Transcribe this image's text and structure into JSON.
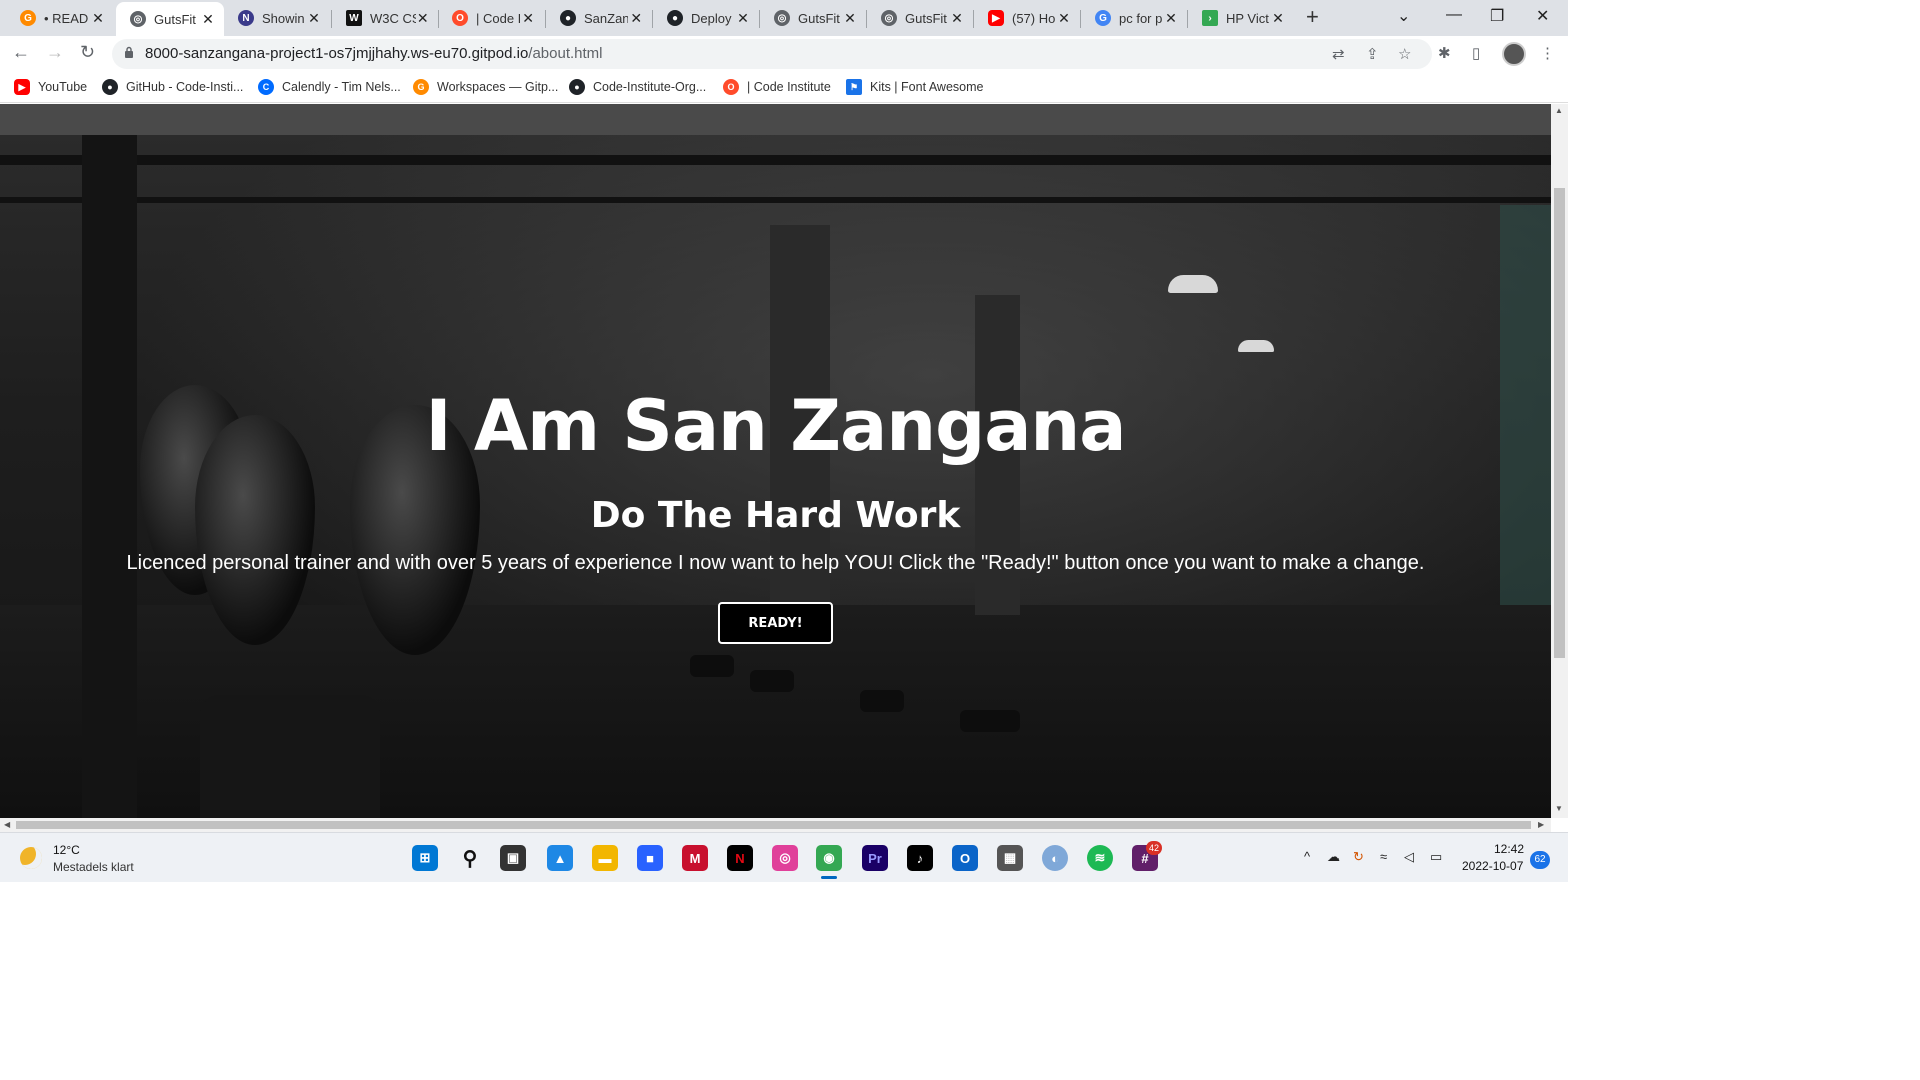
{
  "tabs": [
    {
      "title": "• READ",
      "icon": "gitpod-icon",
      "color": "#ff8a00"
    },
    {
      "title": "GutsFit",
      "icon": "globe-icon",
      "color": "#5f6368",
      "active": true
    },
    {
      "title": "Showin",
      "icon": "flag-icon",
      "color": "#3a3a8a"
    },
    {
      "title": "W3C CS",
      "icon": "w3c-icon",
      "color": "#111111"
    },
    {
      "title": "| Code I",
      "icon": "code-institute-icon",
      "color": "#ff4b2b"
    },
    {
      "title": "SanZan",
      "icon": "github-icon",
      "color": "#1f2328"
    },
    {
      "title": "Deploy",
      "icon": "github-icon",
      "color": "#1f2328"
    },
    {
      "title": "GutsFit",
      "icon": "globe-icon",
      "color": "#5f6368"
    },
    {
      "title": "GutsFit",
      "icon": "globe-icon",
      "color": "#5f6368"
    },
    {
      "title": "(57) Ho",
      "icon": "youtube-icon",
      "color": "#ff0000"
    },
    {
      "title": "pc for p",
      "icon": "google-icon",
      "color": "#4285f4"
    },
    {
      "title": "HP Vict",
      "icon": "chevron-icon",
      "color": "#34a853"
    }
  ],
  "address": {
    "host": "8000-sanzangana-project1-os7jmjjhahy.ws-eu70.gitpod.io",
    "path": "/about.html"
  },
  "bookmarks": [
    {
      "label": "YouTube",
      "icon": "youtube-icon",
      "color": "#ff0000"
    },
    {
      "label": "GitHub - Code-Insti...",
      "icon": "github-icon",
      "color": "#1f2328"
    },
    {
      "label": "Calendly - Tim Nels...",
      "icon": "calendly-icon",
      "color": "#006bff"
    },
    {
      "label": "Workspaces — Gitp...",
      "icon": "gitpod-icon",
      "color": "#ff8a00"
    },
    {
      "label": "Code-Institute-Org...",
      "icon": "github-icon",
      "color": "#1f2328"
    },
    {
      "label": "| Code Institute",
      "icon": "code-institute-icon",
      "color": "#ff4b2b"
    },
    {
      "label": "Kits | Font Awesome",
      "icon": "flag-icon",
      "color": "#1a73e8"
    }
  ],
  "hero": {
    "title": "I Am San Zangana",
    "subtitle": "Do The Hard Work",
    "text": "Licenced personal trainer and with over 5 years of experience I now want to help YOU! Click the \"Ready!\" button once you want to make a change.",
    "button": "READY!"
  },
  "taskbar": {
    "weather_temp": "12°C",
    "weather_desc": "Mestadels klart",
    "time": "12:42",
    "date": "2022-10-07",
    "notifications": "62",
    "slack_badge": "42"
  }
}
